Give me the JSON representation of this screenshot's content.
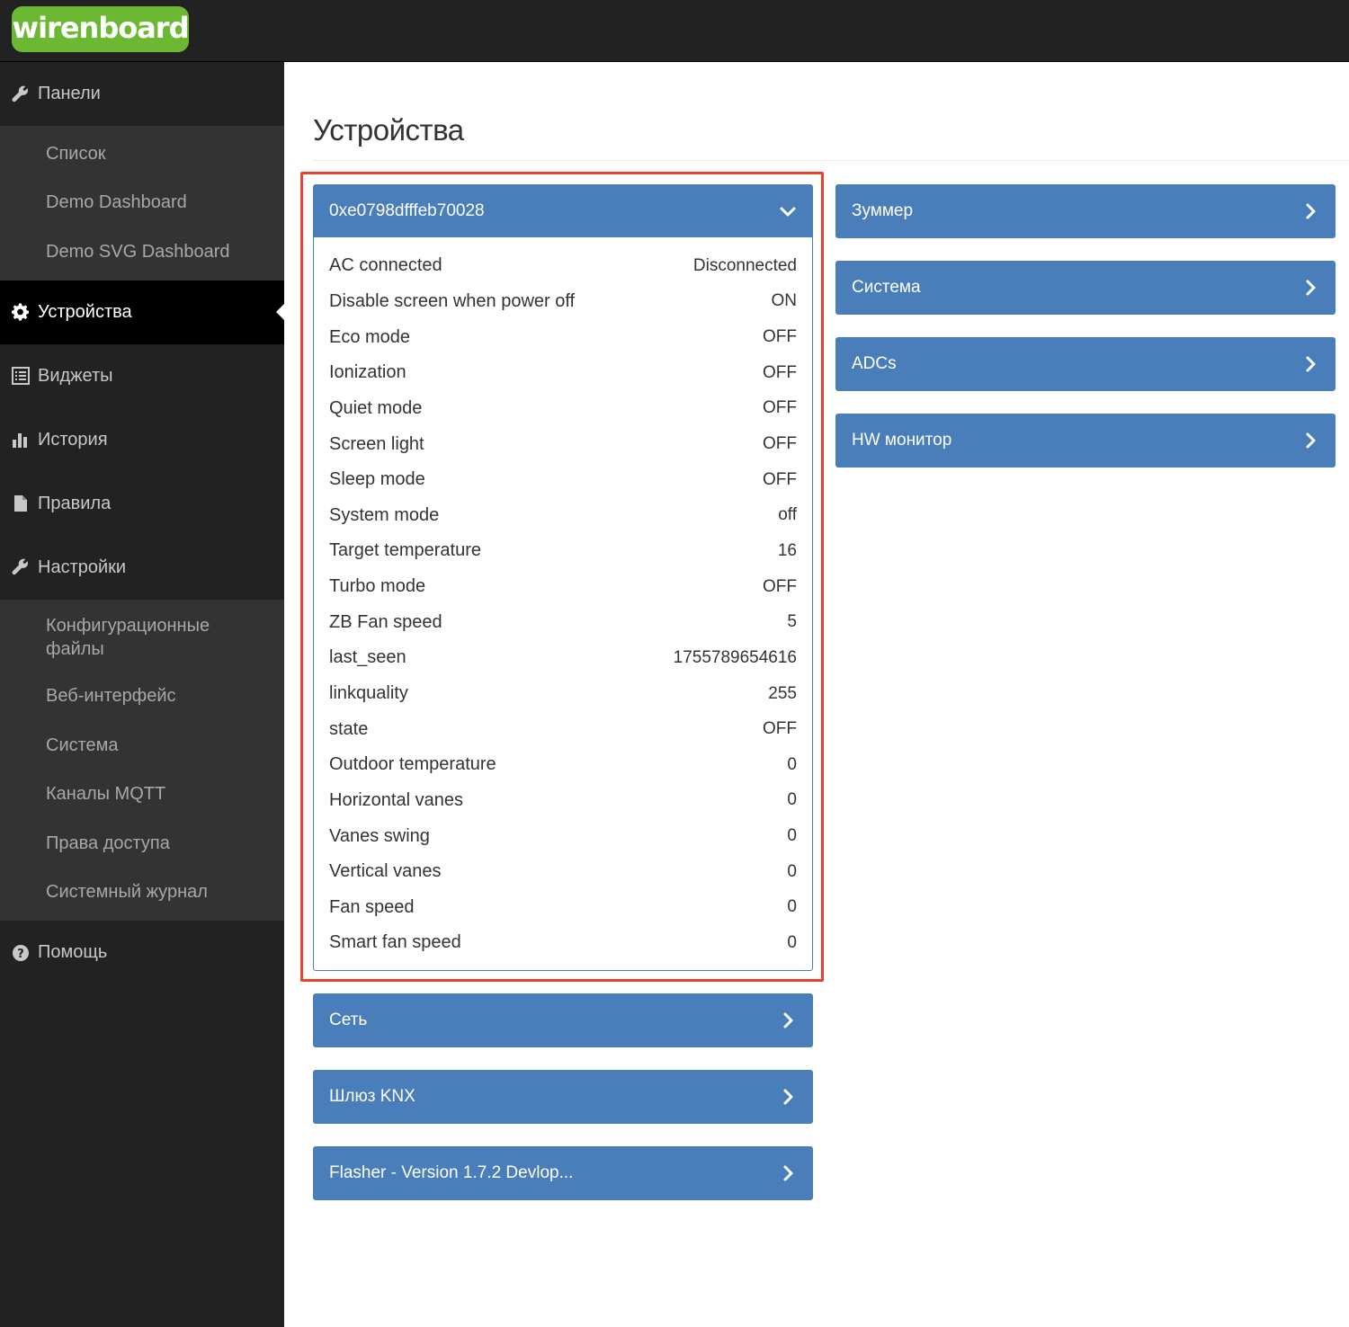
{
  "brand": {
    "logo_text": "wirenboard",
    "logo_color": "#6bb833"
  },
  "sidebar": {
    "panels_label": "Панели",
    "panels_sub": [
      "Список",
      "Demo Dashboard",
      "Demo SVG Dashboard"
    ],
    "devices_label": "Устройства",
    "widgets_label": "Виджеты",
    "history_label": "История",
    "rules_label": "Правила",
    "settings_label": "Настройки",
    "settings_sub": [
      "Конфигурационные файлы",
      "Веб-интерфейс",
      "Система",
      "Каналы MQTT",
      "Права доступа",
      "Системный журнал"
    ],
    "help_label": "Помощь"
  },
  "main": {
    "title": "Устройства",
    "expanded_device": {
      "name": "0xe0798dfffeb70028",
      "controls": [
        {
          "label": "AC connected",
          "value": "Disconnected"
        },
        {
          "label": "Disable screen when power off",
          "value": "ON"
        },
        {
          "label": "Eco mode",
          "value": "OFF"
        },
        {
          "label": "Ionization",
          "value": "OFF"
        },
        {
          "label": "Quiet mode",
          "value": "OFF"
        },
        {
          "label": "Screen light",
          "value": "OFF"
        },
        {
          "label": "Sleep mode",
          "value": "OFF"
        },
        {
          "label": "System mode",
          "value": "off"
        },
        {
          "label": "Target temperature",
          "value": "16"
        },
        {
          "label": "Turbo mode",
          "value": "OFF"
        },
        {
          "label": "ZB Fan speed",
          "value": "5"
        },
        {
          "label": "last_seen",
          "value": "1755789654616"
        },
        {
          "label": "linkquality",
          "value": "255"
        },
        {
          "label": "state",
          "value": "OFF"
        },
        {
          "label": "Outdoor temperature",
          "value": "0"
        },
        {
          "label": "Horizontal vanes",
          "value": "0"
        },
        {
          "label": "Vanes swing",
          "value": "0"
        },
        {
          "label": "Vertical vanes",
          "value": "0"
        },
        {
          "label": "Fan speed",
          "value": "0"
        },
        {
          "label": "Smart fan speed",
          "value": "0"
        }
      ]
    },
    "left_collapsed": [
      "Сеть",
      "Шлюз KNX",
      "Flasher - Version 1.7.2 Devlop..."
    ],
    "right_collapsed": [
      "Зуммер",
      "Система",
      "ADCs",
      "HW монитор"
    ]
  },
  "colors": {
    "panel_blue": "#4a7ebb",
    "highlight_red": "#e8432e",
    "sidebar_bg": "#222222"
  }
}
